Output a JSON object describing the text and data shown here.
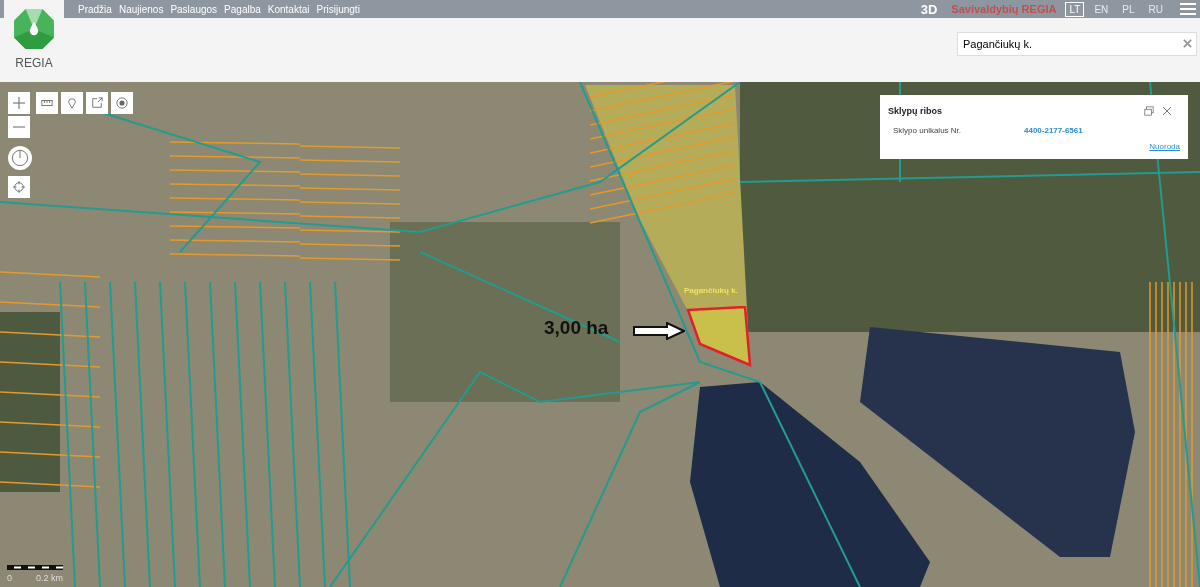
{
  "top_bar": {
    "menu": [
      "Pradžia",
      "Naujienos",
      "Paslaugos",
      "Pagalba",
      "Kontaktai",
      "Prisijungti"
    ],
    "mode": "3D",
    "brand": "Savivaldybių REGIA",
    "languages": [
      {
        "label": "LT",
        "selected": true
      },
      {
        "label": "EN",
        "selected": false
      },
      {
        "label": "PL",
        "selected": false
      },
      {
        "label": "RU",
        "selected": false
      }
    ]
  },
  "logo": {
    "text": "REGIA"
  },
  "search": {
    "value": "Pagančiukų k."
  },
  "map": {
    "place_label": "Pagančiukų k.",
    "area_annotation": "3,00 ha",
    "scale": {
      "start": "0",
      "end": "0.2 km"
    }
  },
  "popup": {
    "title": "Sklypų ribos",
    "field_label": "Sklypo unikalus Nr.",
    "field_value": "4400-2177-6561",
    "link": "Nuoroda"
  }
}
